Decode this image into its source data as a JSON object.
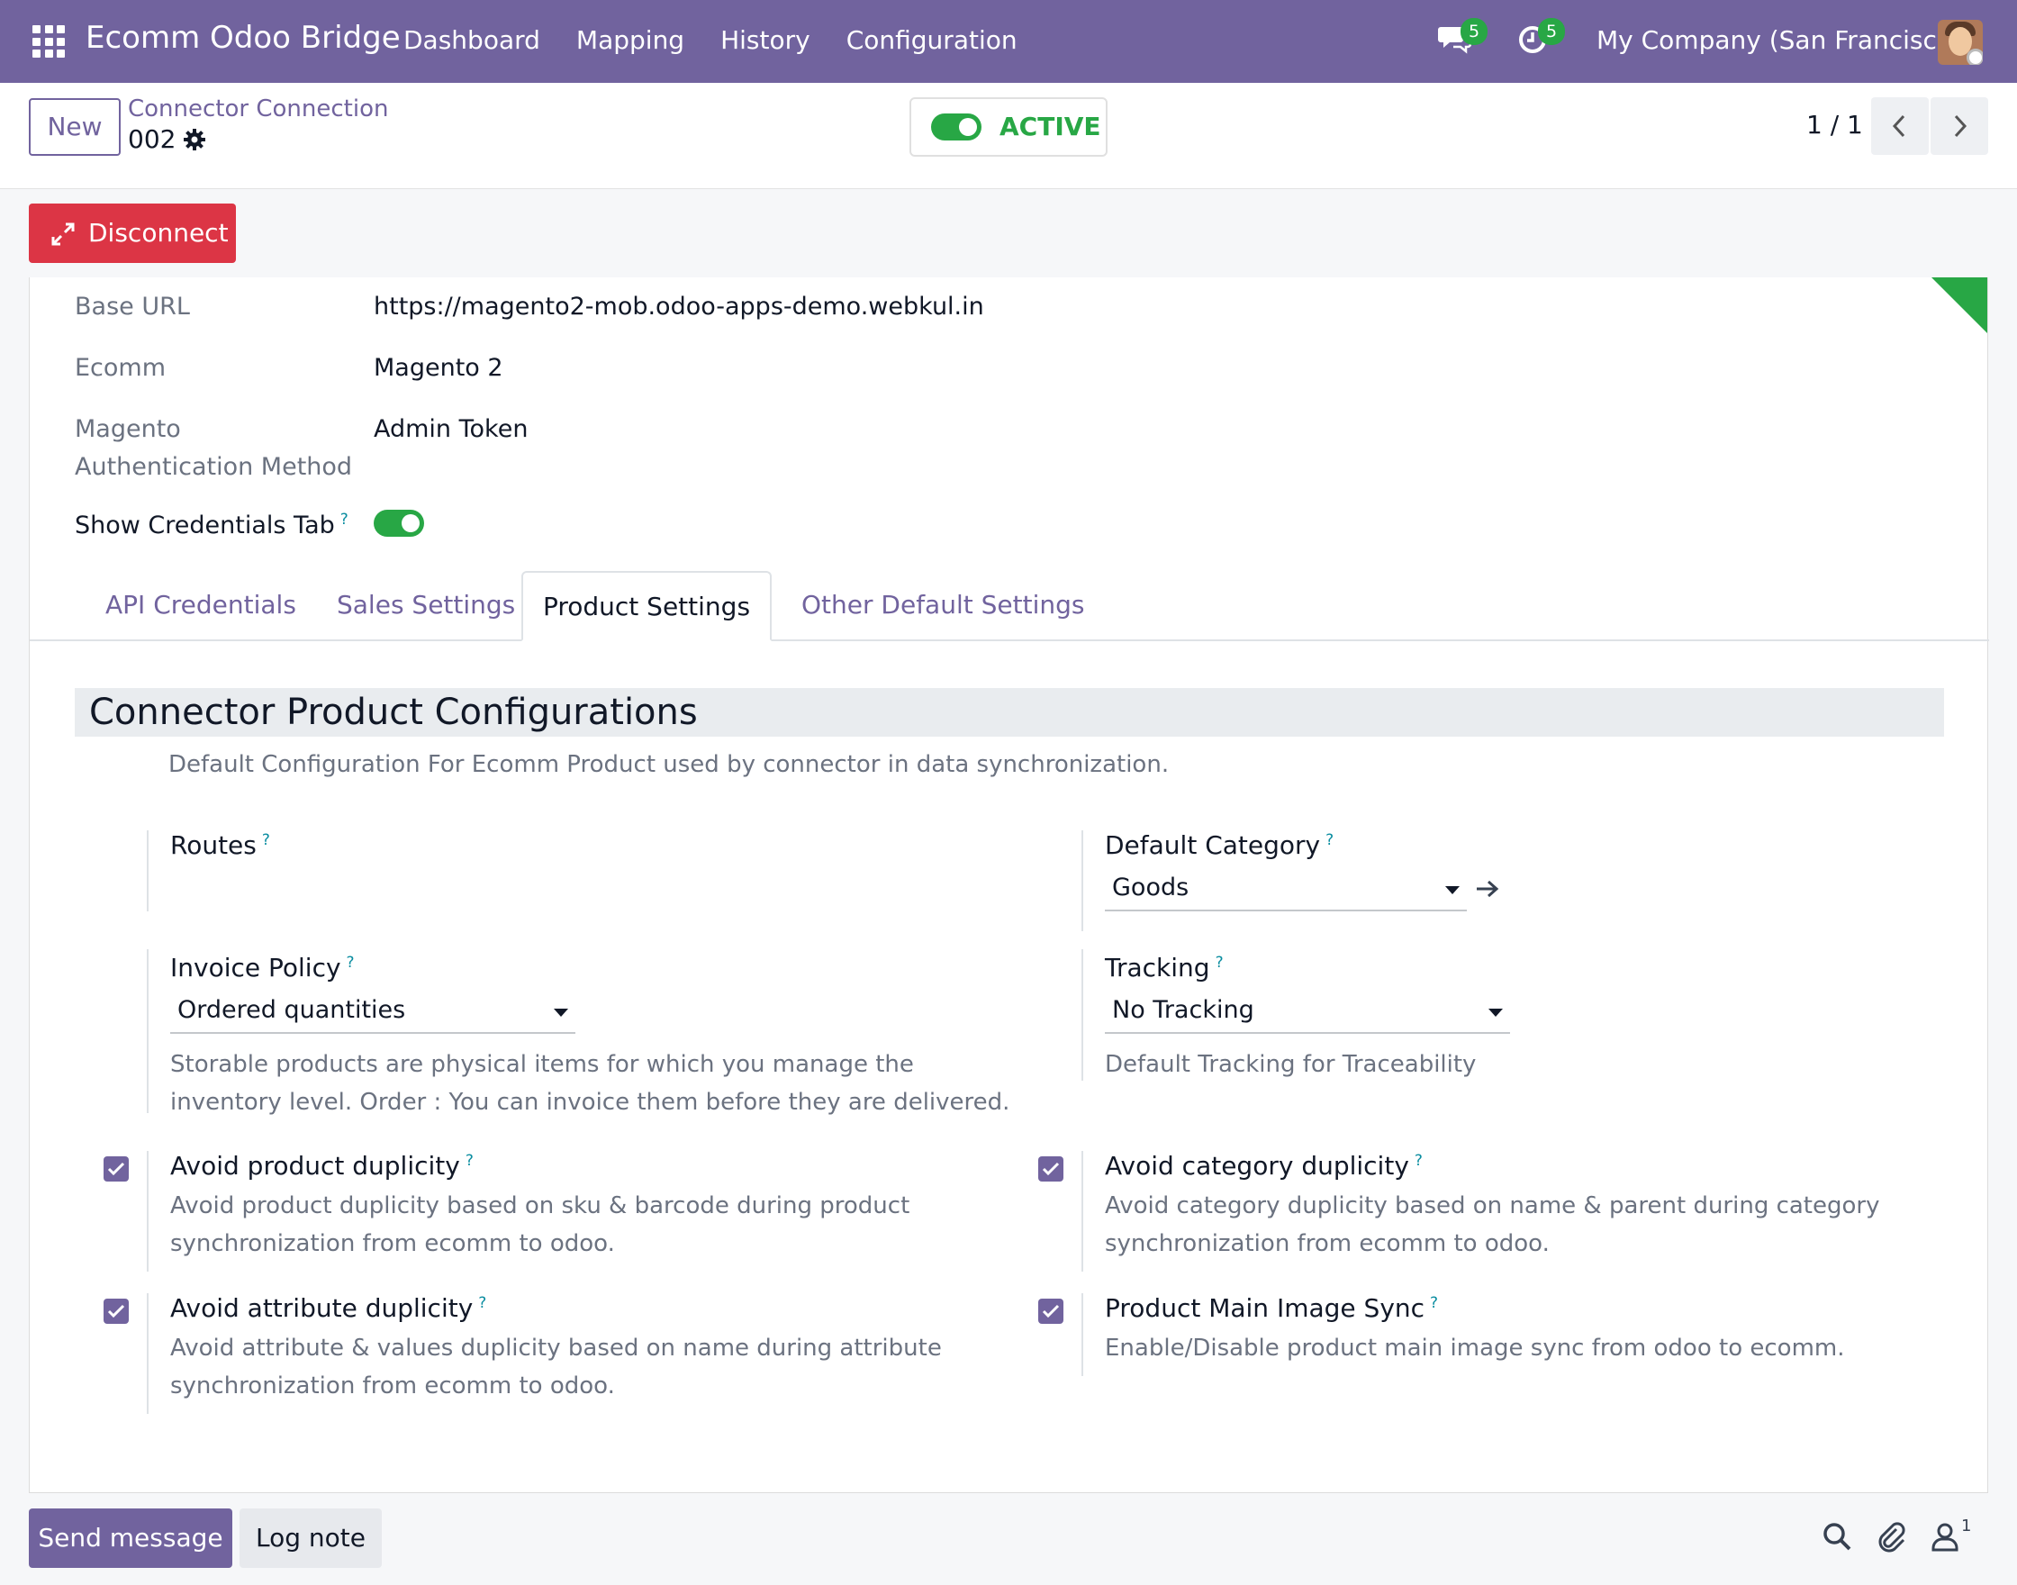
{
  "navbar": {
    "brand": "Ecomm Odoo Bridge",
    "menu": [
      "Dashboard",
      "Mapping",
      "History",
      "Configuration"
    ],
    "messages_badge": "5",
    "activities_badge": "5",
    "company": "My Company (San Francisco)",
    "nav_color": "#71639e"
  },
  "control_panel": {
    "new_label": "New",
    "breadcrumb": "Connector Connection",
    "record_name": "002",
    "status_label": "ACTIVE",
    "pager": "1 / 1"
  },
  "actions": {
    "disconnect_label": "Disconnect"
  },
  "fields": {
    "base_url_label": "Base URL",
    "base_url_value": "https://magento2-mob.odoo-apps-demo.webkul.in",
    "ecomm_label": "Ecomm",
    "ecomm_value": "Magento 2",
    "auth_label_1": "Magento",
    "auth_label_2": "Authentication Method",
    "auth_value": "Admin Token",
    "show_credentials_label": "Show Credentials Tab",
    "help_mark": "?"
  },
  "tabs": [
    "API Credentials",
    "Sales Settings",
    "Product Settings",
    "Other Default Settings"
  ],
  "product_settings": {
    "title": "Connector Product Configurations",
    "description": "Default Configuration For Ecomm Product used by connector in data synchronization.",
    "routes_label": "Routes",
    "default_category_label": "Default Category",
    "default_category_value": "Goods",
    "invoice_policy_label": "Invoice Policy",
    "invoice_policy_value": "Ordered quantities",
    "invoice_policy_desc_1": "Storable products are physical items for which you manage the",
    "invoice_policy_desc_2": "inventory level. Order : You can invoice them before they are delivered.",
    "tracking_label": "Tracking",
    "tracking_value": "No Tracking",
    "tracking_desc": "Default Tracking for Traceability",
    "avoid_product_label": "Avoid product duplicity",
    "avoid_product_desc_1": "Avoid product duplicity based on sku & barcode during product",
    "avoid_product_desc_2": "synchronization from ecomm to odoo.",
    "avoid_category_label": "Avoid category duplicity",
    "avoid_category_desc_1": "Avoid category duplicity based on name & parent during category",
    "avoid_category_desc_2": "synchronization from ecomm to odoo.",
    "avoid_attribute_label": "Avoid attribute duplicity",
    "avoid_attribute_desc_1": "Avoid attribute & values duplicity based on name during attribute",
    "avoid_attribute_desc_2": "synchronization from ecomm to odoo.",
    "main_image_label": "Product Main Image Sync",
    "main_image_desc": "Enable/Disable product main image sync from odoo to ecomm."
  },
  "chatter": {
    "send_message": "Send message",
    "log_note": "Log note",
    "followers_count": "1"
  }
}
